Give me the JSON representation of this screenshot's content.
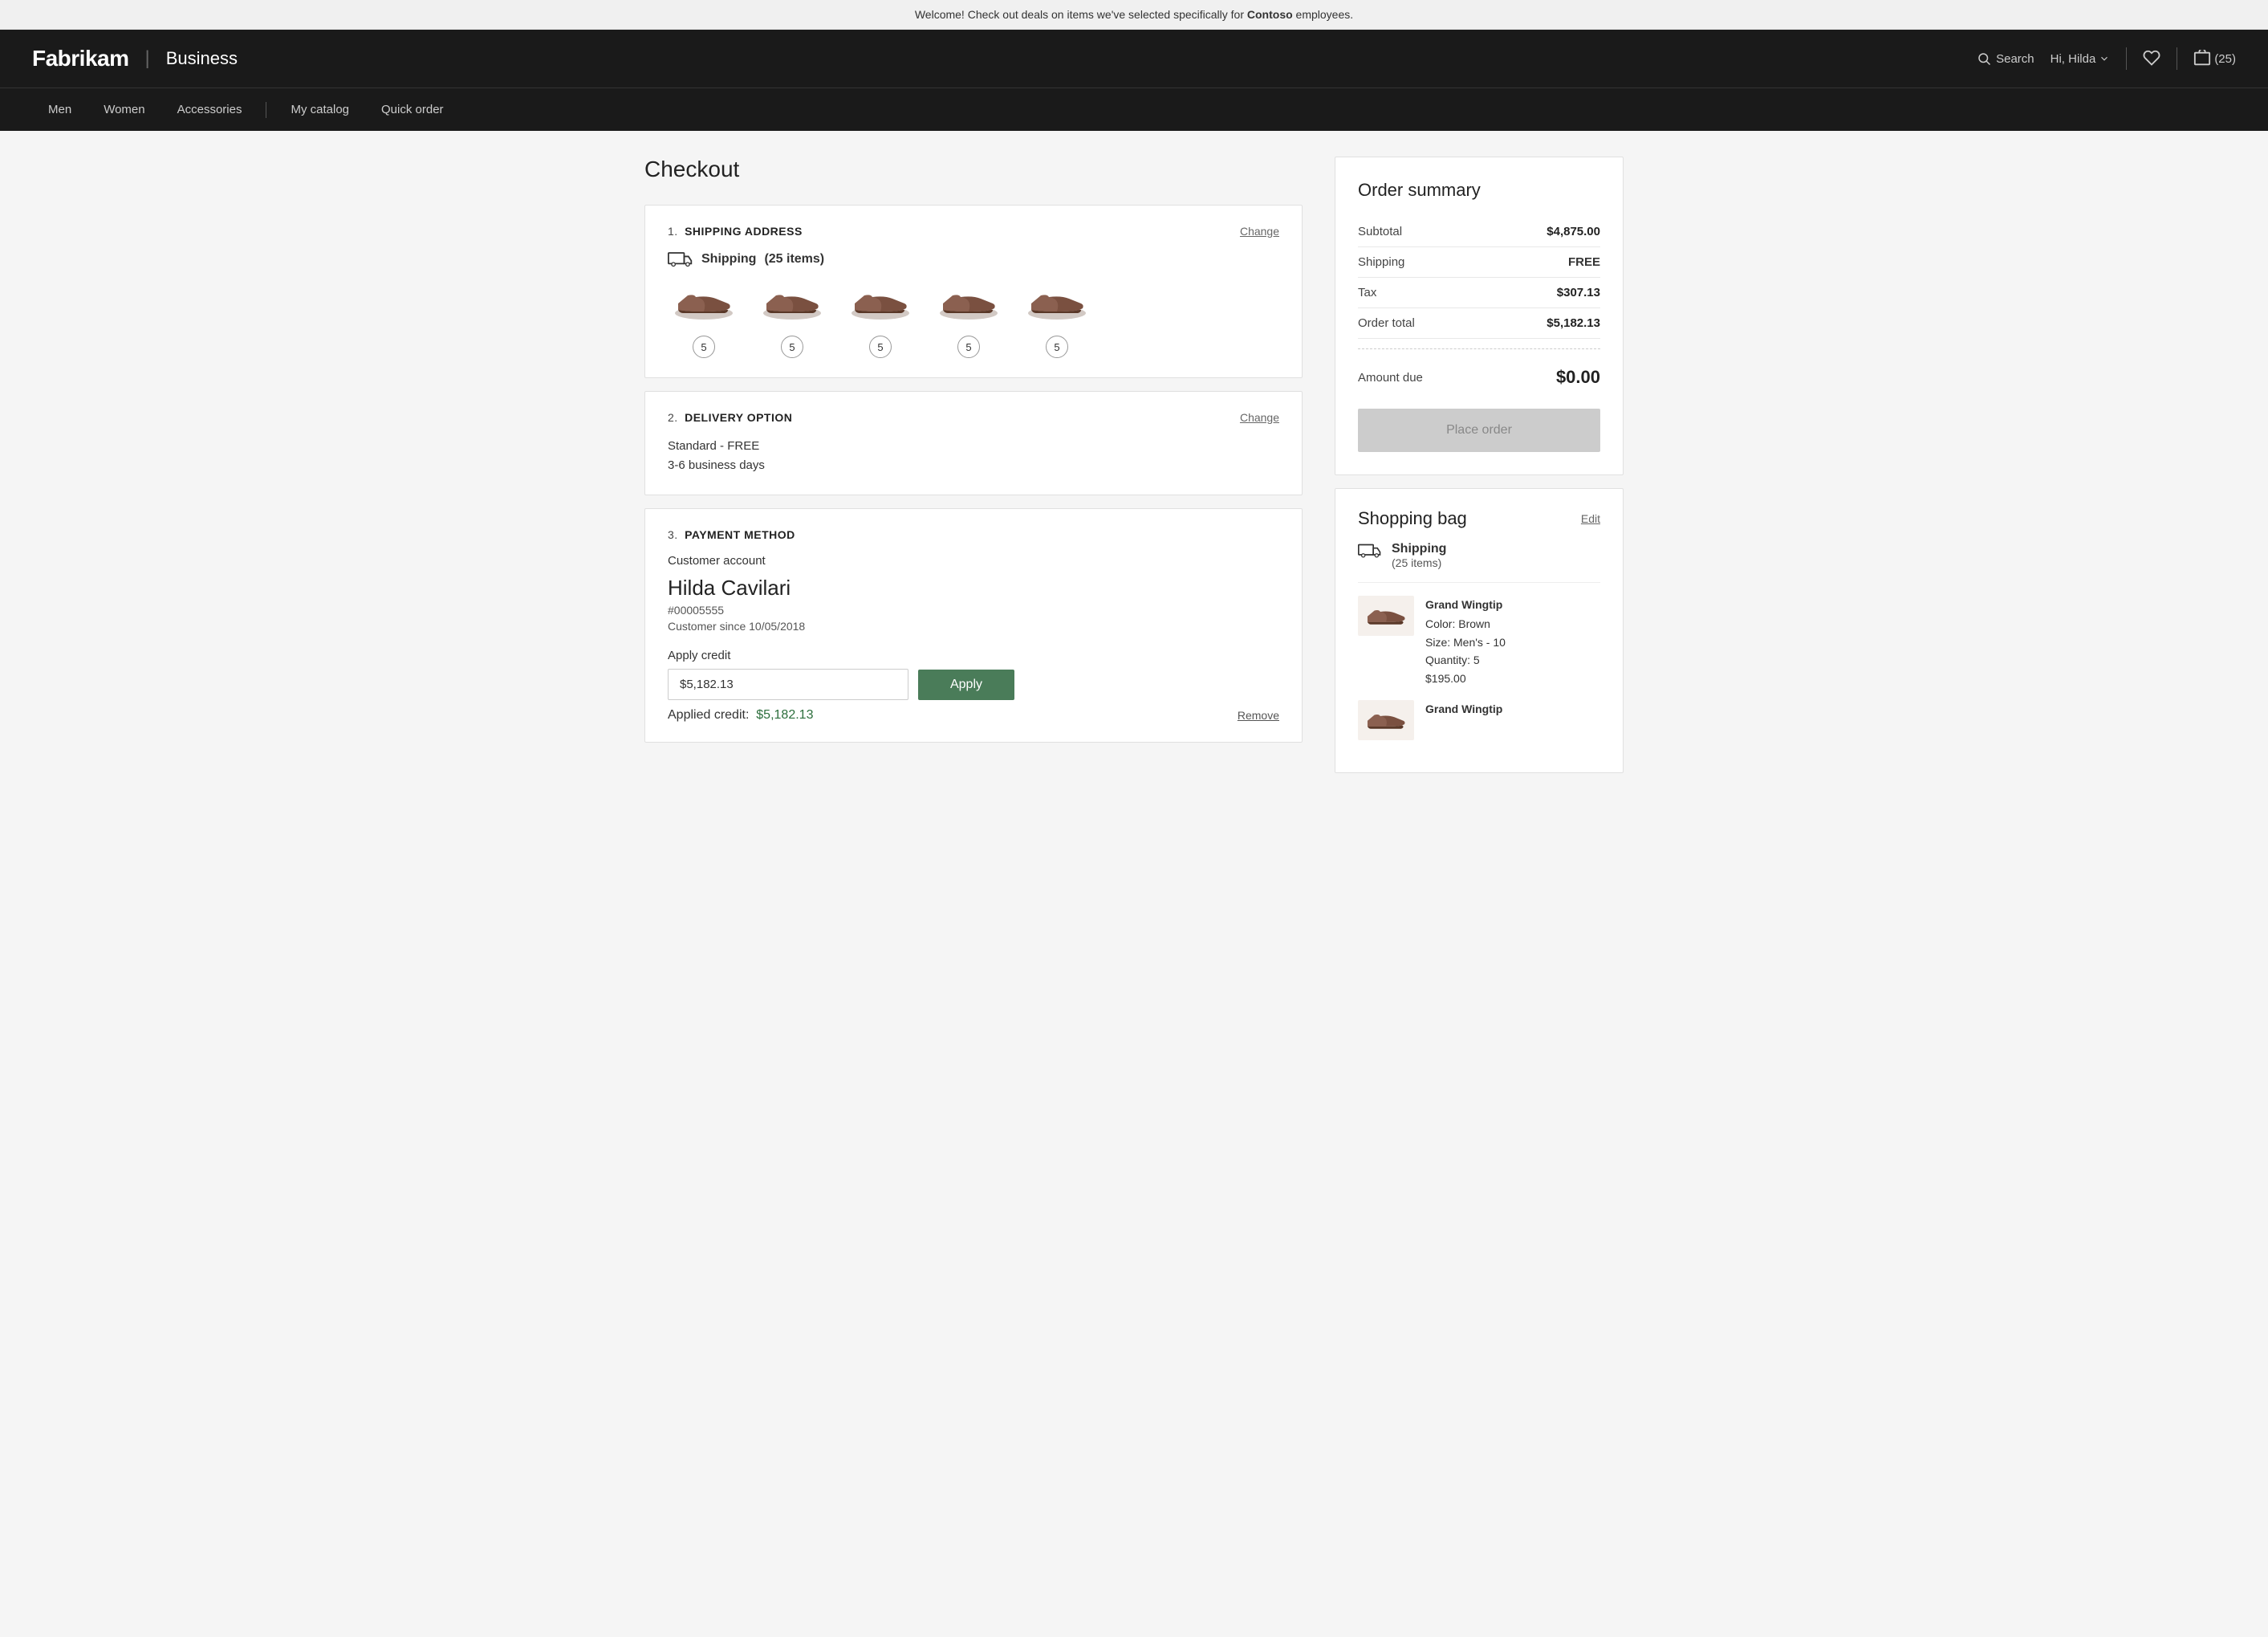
{
  "announcement": {
    "text": "Welcome! Check out deals on items we've selected specifically for",
    "company": "Contoso",
    "suffix": " employees."
  },
  "header": {
    "logo": "Fabrikam",
    "separator": "|",
    "business": "Business",
    "search_label": "Search",
    "user_label": "Hi, Hilda",
    "cart_count": "(25)"
  },
  "nav": {
    "items": [
      "Men",
      "Women",
      "Accessories",
      "My catalog",
      "Quick order"
    ]
  },
  "page": {
    "title": "Checkout"
  },
  "shipping_section": {
    "number": "1.",
    "title": "SHIPPING ADDRESS",
    "change_label": "Change",
    "shipping_label": "Shipping",
    "items_count": "(25 items)",
    "products": [
      {
        "qty": 5
      },
      {
        "qty": 5
      },
      {
        "qty": 5
      },
      {
        "qty": 5
      },
      {
        "qty": 5
      }
    ]
  },
  "delivery_section": {
    "number": "2.",
    "title": "DELIVERY OPTION",
    "change_label": "Change",
    "option": "Standard - FREE",
    "days": "3-6 business days"
  },
  "payment_section": {
    "number": "3.",
    "title": "PAYMENT METHOD",
    "customer_account_label": "Customer account",
    "customer_name": "Hilda Cavilari",
    "customer_id": "#00005555",
    "customer_since": "Customer since 10/05/2018",
    "apply_credit_label": "Apply credit",
    "credit_value": "$5,182.13",
    "apply_button_label": "Apply",
    "applied_credit_label": "Applied credit:",
    "applied_credit_amount": "$5,182.13",
    "remove_label": "Remove"
  },
  "order_summary": {
    "title": "Order summary",
    "subtotal_label": "Subtotal",
    "subtotal_value": "$4,875.00",
    "shipping_label": "Shipping",
    "shipping_value": "FREE",
    "tax_label": "Tax",
    "tax_value": "$307.13",
    "order_total_label": "Order total",
    "order_total_value": "$5,182.13",
    "amount_due_label": "Amount due",
    "amount_due_value": "$0.00",
    "place_order_label": "Place order"
  },
  "shopping_bag": {
    "title": "Shopping bag",
    "edit_label": "Edit",
    "shipping_title": "Shipping",
    "items_count": "(25 items)",
    "products": [
      {
        "name": "Grand Wingtip",
        "color": "Color: Brown",
        "size": "Size: Men's - 10",
        "quantity": "Quantity: 5",
        "price": "$195.00"
      },
      {
        "name": "Grand Wingtip",
        "color": "",
        "size": "",
        "quantity": "",
        "price": ""
      }
    ]
  }
}
